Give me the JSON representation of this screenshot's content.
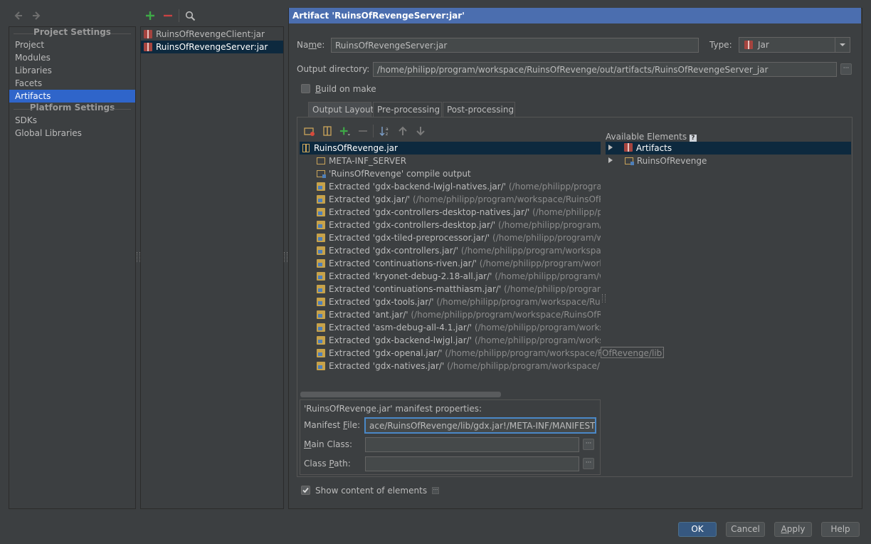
{
  "left_panel": {
    "project_settings_header": "Project Settings",
    "platform_settings_header": "Platform Settings",
    "project_items": [
      "Project",
      "Modules",
      "Libraries",
      "Facets",
      "Artifacts"
    ],
    "platform_items": [
      "SDKs",
      "Global Libraries"
    ],
    "selected": "Artifacts"
  },
  "artifact_list": {
    "items": [
      "RuinsOfRevengeClient:jar",
      "RuinsOfRevengeServer:jar"
    ],
    "selected": "RuinsOfRevengeServer:jar"
  },
  "header": {
    "title": "Artifact 'RuinsOfRevengeServer:jar'"
  },
  "form": {
    "name_label_pre": "Na",
    "name_label_u": "m",
    "name_label_post": "e:",
    "name_value": "RuinsOfRevengeServer:jar",
    "type_label": "Type:",
    "type_value": "Jar",
    "output_dir_label": "Output directory:",
    "output_dir_value": "/home/philipp/program/workspace/RuinsOfRevenge/out/artifacts/RuinsOfRevengeServer_jar",
    "build_on_make_u": "B",
    "build_on_make_rest": "uild on make",
    "build_on_make_checked": false
  },
  "tabs": [
    "Output Layout",
    "Pre-processing",
    "Post-processing"
  ],
  "active_tab": "Output Layout",
  "layout_tree": {
    "root": "RuinsOfRevenge.jar",
    "children": [
      {
        "type": "folder",
        "text": "META-INF_SERVER",
        "path": ""
      },
      {
        "type": "module",
        "text": "'RuinsOfRevenge' compile output",
        "path": ""
      },
      {
        "type": "extracted",
        "text": "Extracted 'gdx-backend-lwjgl-natives.jar/'",
        "path": " (/home/philipp/program/w"
      },
      {
        "type": "extracted",
        "text": "Extracted 'gdx.jar/'",
        "path": " (/home/philipp/program/workspace/RuinsOfRe"
      },
      {
        "type": "extracted",
        "text": "Extracted 'gdx-controllers-desktop-natives.jar/'",
        "path": " (/home/philipp/progr"
      },
      {
        "type": "extracted",
        "text": "Extracted 'gdx-controllers-desktop.jar/'",
        "path": " (/home/philipp/program/wor"
      },
      {
        "type": "extracted",
        "text": "Extracted 'gdx-tiled-preprocessor.jar/'",
        "path": " (/home/philipp/program/work"
      },
      {
        "type": "extracted",
        "text": "Extracted 'gdx-controllers.jar/'",
        "path": " (/home/philipp/program/workspace/F"
      },
      {
        "type": "extracted",
        "text": "Extracted 'continuations-riven.jar/'",
        "path": " (/home/philipp/program/workspa"
      },
      {
        "type": "extracted",
        "text": "Extracted 'kryonet-debug-2.18-all.jar/'",
        "path": " (/home/philipp/program/work"
      },
      {
        "type": "extracted",
        "text": "Extracted 'continuations-matthiasm.jar/'",
        "path": " (/home/philipp/program/wo"
      },
      {
        "type": "extracted",
        "text": "Extracted 'gdx-tools.jar/'",
        "path": " (/home/philipp/program/workspace/RuinsC"
      },
      {
        "type": "extracted",
        "text": "Extracted 'ant.jar/'",
        "path": " (/home/philipp/program/workspace/RuinsOfReve"
      },
      {
        "type": "extracted",
        "text": "Extracted 'asm-debug-all-4.1.jar/'",
        "path": " (/home/philipp/program/workspac"
      },
      {
        "type": "extracted",
        "text": "Extracted 'gdx-backend-lwjgl.jar/'",
        "path": " (/home/philipp/program/workspac"
      },
      {
        "type": "extracted",
        "text": "Extracted 'gdx-openal.jar/'",
        "path": " (/home/philipp/program/workspace/Ruins"
      },
      {
        "type": "extracted",
        "text": "Extracted 'gdx-natives.jar/'",
        "path": " (/home/philipp/program/workspace/Ruin"
      }
    ],
    "tooltip_tail": "OfRevenge/lib)"
  },
  "available": {
    "label": "Available Elements",
    "items": [
      "Artifacts",
      "RuinsOfRevenge"
    ]
  },
  "manifest": {
    "title": "'RuinsOfRevenge.jar' manifest properties:",
    "file_label_pre": "Manifest ",
    "file_label_u": "F",
    "file_label_post": "ile:",
    "file_value": "ace/RuinsOfRevenge/lib/gdx.jar!/META-INF/MANIFEST.MF",
    "main_class_u": "M",
    "main_class_rest": "ain Class:",
    "main_class_value": "",
    "class_path_pre": "Class ",
    "class_path_u": "P",
    "class_path_post": "ath:",
    "class_path_value": ""
  },
  "show_content": {
    "label": "Show content of elements",
    "checked": true
  },
  "buttons": {
    "ok": "OK",
    "cancel": "Cancel",
    "apply_u": "A",
    "apply_rest": "pply",
    "help": "Help"
  },
  "colors": {
    "background": "#3c3f41",
    "selection": "#2f65ca",
    "title_bar": "#4b6eaf",
    "add": "#3ea947",
    "remove": "#c94343"
  }
}
